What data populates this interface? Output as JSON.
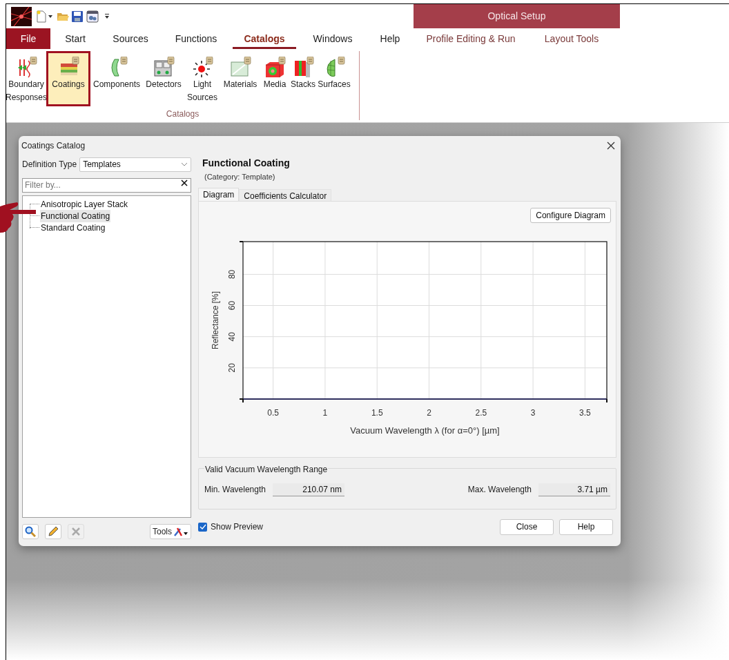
{
  "app": {
    "context_tab": "Optical Setup"
  },
  "ribbon_tabs": [
    {
      "label": "File",
      "kind": "file",
      "selected": false
    },
    {
      "label": "Start",
      "kind": "tab",
      "selected": false
    },
    {
      "label": "Sources",
      "kind": "tab",
      "selected": false
    },
    {
      "label": "Functions",
      "kind": "tab",
      "selected": false
    },
    {
      "label": "Catalogs",
      "kind": "tab",
      "selected": true
    },
    {
      "label": "Windows",
      "kind": "tab",
      "selected": false
    },
    {
      "label": "Help",
      "kind": "tab",
      "selected": false
    },
    {
      "label": "Profile Editing & Run",
      "kind": "context",
      "selected": false
    },
    {
      "label": "Layout Tools",
      "kind": "context",
      "selected": false
    }
  ],
  "ribbon_group": {
    "label": "Catalogs",
    "buttons": [
      {
        "label": "Boundary Responses",
        "selected": false
      },
      {
        "label": "Coatings",
        "selected": true
      },
      {
        "label": "Components",
        "selected": false
      },
      {
        "label": "Detectors",
        "selected": false
      },
      {
        "label": "Light Sources",
        "selected": false
      },
      {
        "label": "Materials",
        "selected": false
      },
      {
        "label": "Media",
        "selected": false
      },
      {
        "label": "Stacks",
        "selected": false
      },
      {
        "label": "Surfaces",
        "selected": false
      }
    ]
  },
  "dialog": {
    "title": "Coatings Catalog",
    "definition_type": {
      "label": "Definition Type",
      "value": "Templates"
    },
    "filter": {
      "placeholder": "Filter by..."
    },
    "tree": [
      {
        "label": "Anisotropic Layer Stack",
        "selected": false
      },
      {
        "label": "Functional Coating",
        "selected": true
      },
      {
        "label": "Standard Coating",
        "selected": false
      }
    ],
    "tools_button": "Tools",
    "heading": "Functional Coating",
    "subheading": "(Category: Template)",
    "tabs": [
      {
        "label": "Diagram",
        "selected": true
      },
      {
        "label": "Coefficients Calculator",
        "selected": false
      }
    ],
    "configure_button": "Configure Diagram",
    "chart_data": {
      "type": "line",
      "grid": true,
      "xlabel": "Vacuum Wavelength λ (for α=0°) [µm]",
      "ylabel": "Reflectance [%]",
      "xlim": [
        0.21,
        3.71
      ],
      "ylim": [
        0,
        101
      ],
      "xticks": [
        0.5,
        1,
        1.5,
        2,
        2.5,
        3,
        3.5
      ],
      "yticks": [
        20,
        40,
        60,
        80
      ]
    },
    "range_group": {
      "title": "Valid Vacuum Wavelength Range",
      "min_label": "Min. Wavelength",
      "min_value": "210.07 nm",
      "max_label": "Max. Wavelength",
      "max_value": "3.71 µm"
    },
    "show_preview": {
      "label": "Show Preview",
      "checked": true
    },
    "buttons": [
      "Close",
      "Help"
    ]
  }
}
